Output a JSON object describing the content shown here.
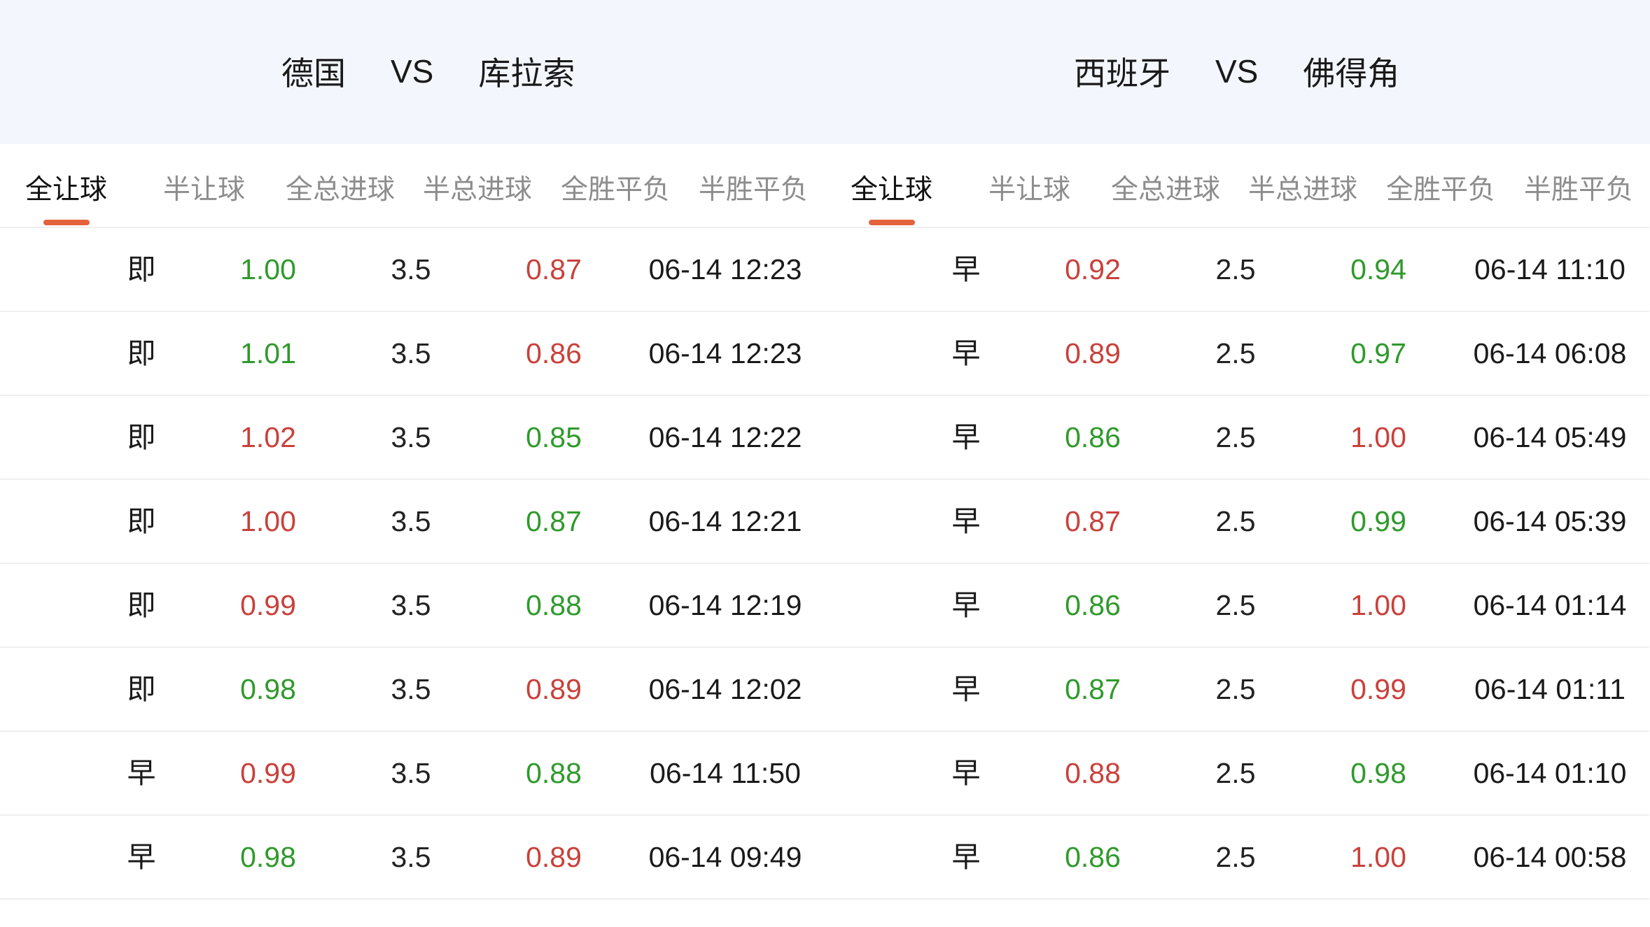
{
  "colors": {
    "up": "#c9413b",
    "down": "#2f9a2b",
    "accent": "#e4633d",
    "header_bg": "#f3f7fd"
  },
  "panels": [
    {
      "home": "德国",
      "vs": "VS",
      "away": "库拉索",
      "tabs": [
        "全让球",
        "半让球",
        "全总进球",
        "半总进球",
        "全胜平负",
        "半胜平负"
      ],
      "active_tab": 0,
      "rows": [
        {
          "type": "即",
          "home_odds": "1.00",
          "home_trend": "down",
          "line": "3.5",
          "away_odds": "0.87",
          "away_trend": "up",
          "time": "06-14 12:23"
        },
        {
          "type": "即",
          "home_odds": "1.01",
          "home_trend": "down",
          "line": "3.5",
          "away_odds": "0.86",
          "away_trend": "up",
          "time": "06-14 12:23"
        },
        {
          "type": "即",
          "home_odds": "1.02",
          "home_trend": "up",
          "line": "3.5",
          "away_odds": "0.85",
          "away_trend": "down",
          "time": "06-14 12:22"
        },
        {
          "type": "即",
          "home_odds": "1.00",
          "home_trend": "up",
          "line": "3.5",
          "away_odds": "0.87",
          "away_trend": "down",
          "time": "06-14 12:21"
        },
        {
          "type": "即",
          "home_odds": "0.99",
          "home_trend": "up",
          "line": "3.5",
          "away_odds": "0.88",
          "away_trend": "down",
          "time": "06-14 12:19"
        },
        {
          "type": "即",
          "home_odds": "0.98",
          "home_trend": "down",
          "line": "3.5",
          "away_odds": "0.89",
          "away_trend": "up",
          "time": "06-14 12:02"
        },
        {
          "type": "早",
          "home_odds": "0.99",
          "home_trend": "up",
          "line": "3.5",
          "away_odds": "0.88",
          "away_trend": "down",
          "time": "06-14 11:50"
        },
        {
          "type": "早",
          "home_odds": "0.98",
          "home_trend": "down",
          "line": "3.5",
          "away_odds": "0.89",
          "away_trend": "up",
          "time": "06-14 09:49"
        }
      ]
    },
    {
      "home": "西班牙",
      "vs": "VS",
      "away": "佛得角",
      "tabs": [
        "全让球",
        "半让球",
        "全总进球",
        "半总进球",
        "全胜平负",
        "半胜平负"
      ],
      "active_tab": 0,
      "rows": [
        {
          "type": "早",
          "home_odds": "0.92",
          "home_trend": "up",
          "line": "2.5",
          "away_odds": "0.94",
          "away_trend": "down",
          "time": "06-14 11:10"
        },
        {
          "type": "早",
          "home_odds": "0.89",
          "home_trend": "up",
          "line": "2.5",
          "away_odds": "0.97",
          "away_trend": "down",
          "time": "06-14 06:08"
        },
        {
          "type": "早",
          "home_odds": "0.86",
          "home_trend": "down",
          "line": "2.5",
          "away_odds": "1.00",
          "away_trend": "up",
          "time": "06-14 05:49"
        },
        {
          "type": "早",
          "home_odds": "0.87",
          "home_trend": "up",
          "line": "2.5",
          "away_odds": "0.99",
          "away_trend": "down",
          "time": "06-14 05:39"
        },
        {
          "type": "早",
          "home_odds": "0.86",
          "home_trend": "down",
          "line": "2.5",
          "away_odds": "1.00",
          "away_trend": "up",
          "time": "06-14 01:14"
        },
        {
          "type": "早",
          "home_odds": "0.87",
          "home_trend": "down",
          "line": "2.5",
          "away_odds": "0.99",
          "away_trend": "up",
          "time": "06-14 01:11"
        },
        {
          "type": "早",
          "home_odds": "0.88",
          "home_trend": "up",
          "line": "2.5",
          "away_odds": "0.98",
          "away_trend": "down",
          "time": "06-14 01:10"
        },
        {
          "type": "早",
          "home_odds": "0.86",
          "home_trend": "down",
          "line": "2.5",
          "away_odds": "1.00",
          "away_trend": "up",
          "time": "06-14 00:58"
        }
      ]
    }
  ]
}
